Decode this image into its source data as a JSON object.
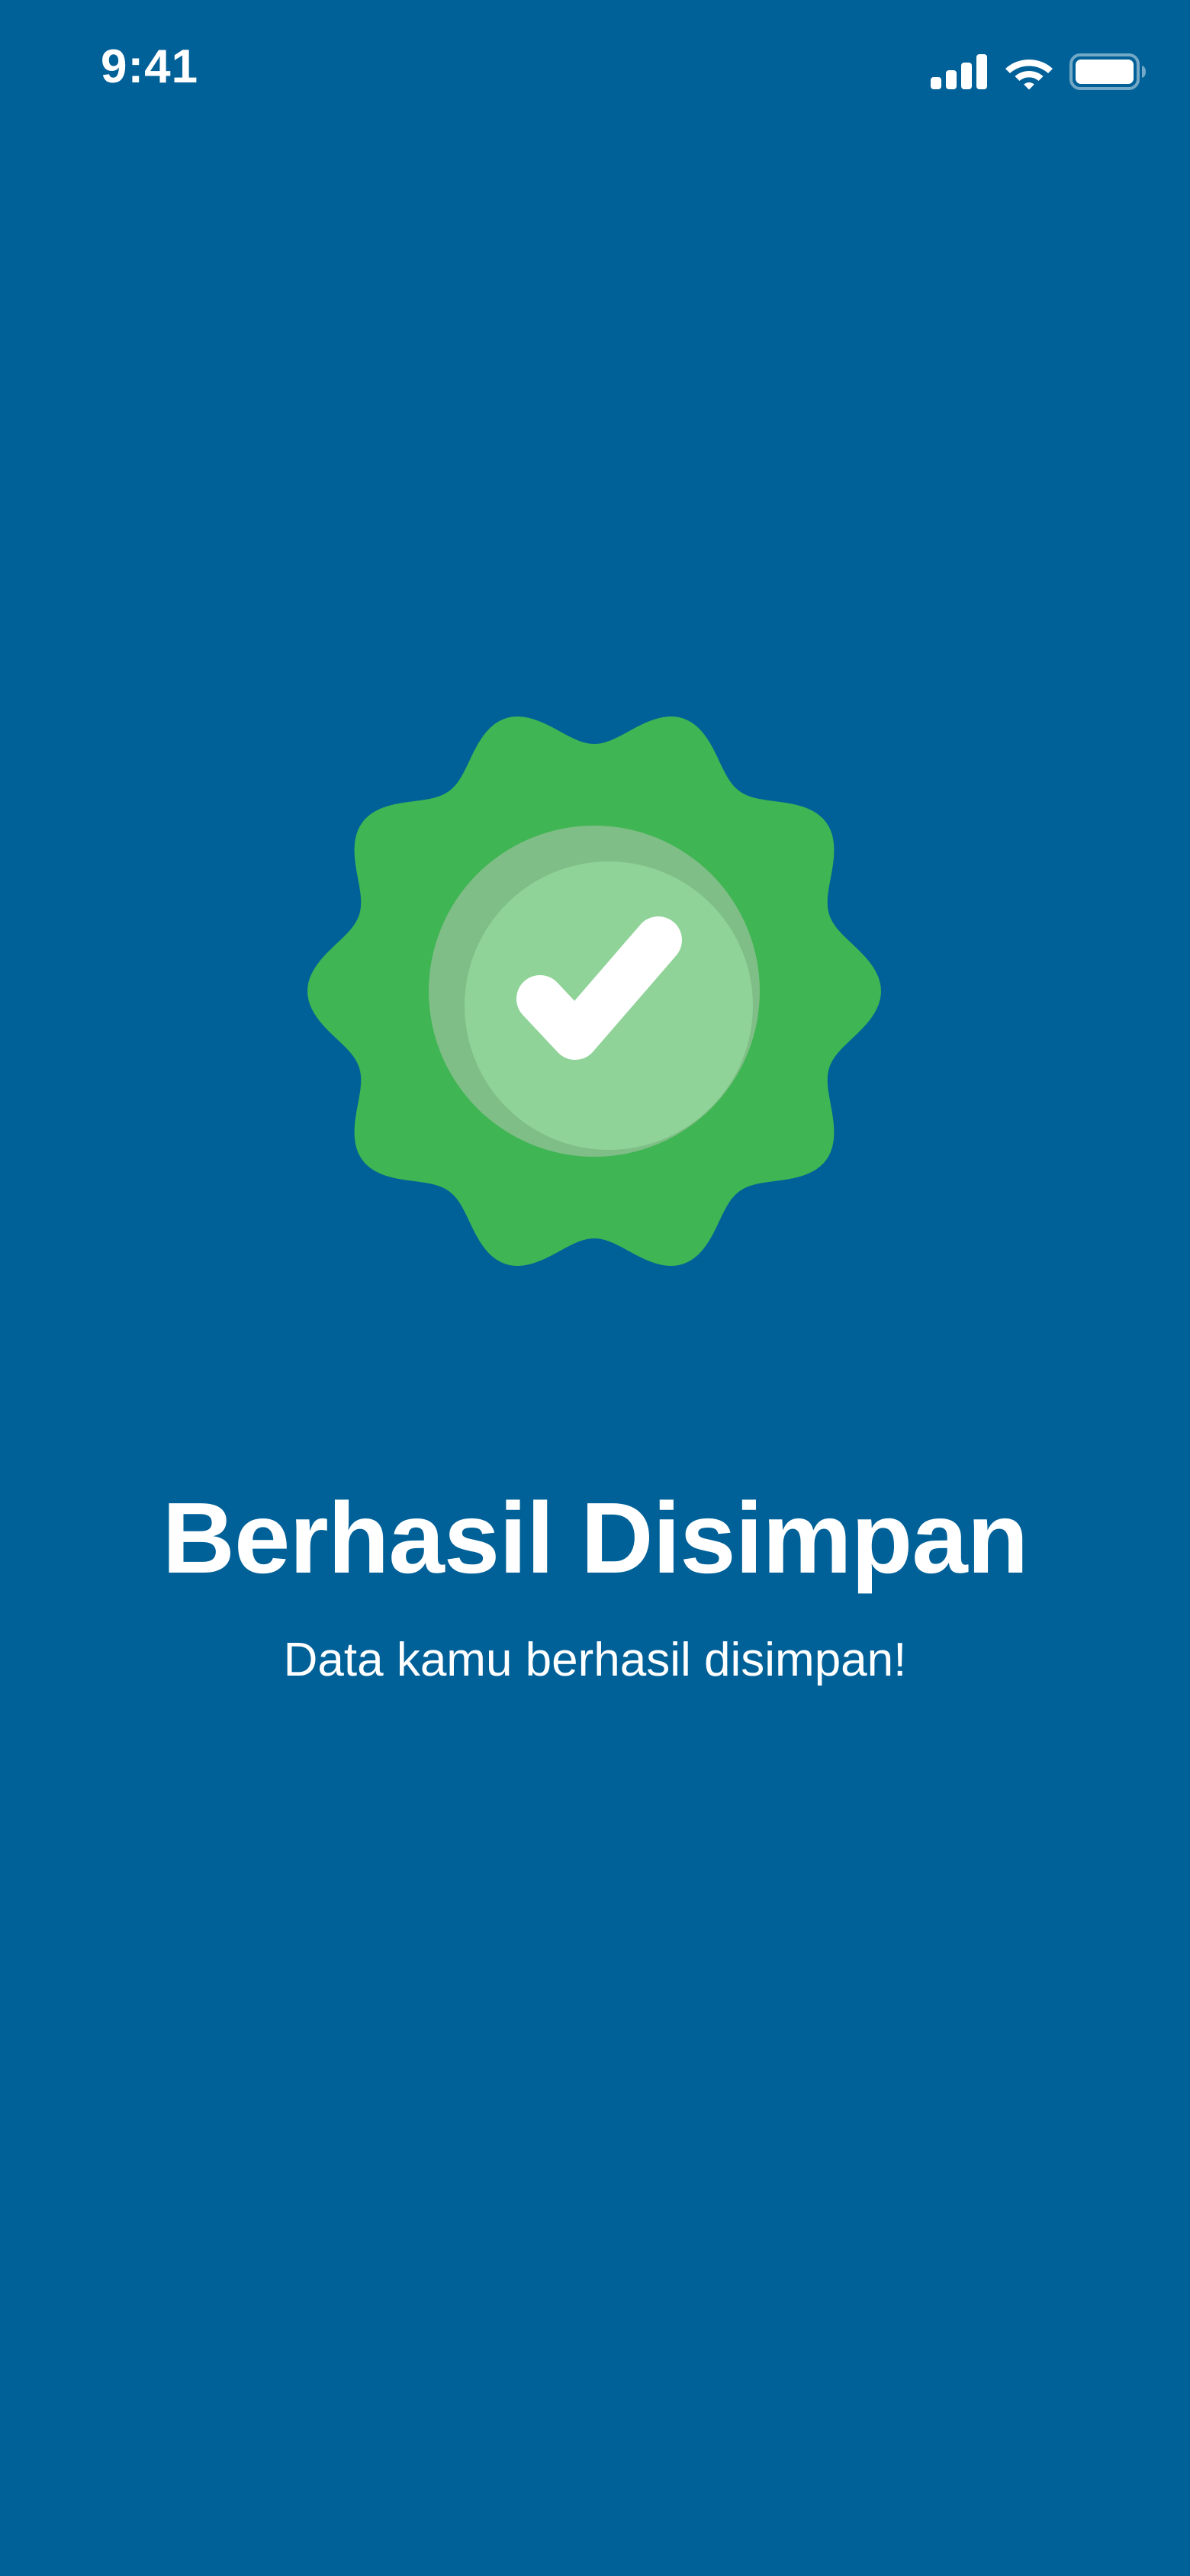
{
  "status_bar": {
    "time": "9:41",
    "icons": [
      "cellular-signal-icon",
      "wifi-icon",
      "battery-icon"
    ]
  },
  "badge": {
    "icon": "verified-check-badge-icon",
    "colors": {
      "outer": "#3FB553",
      "inner": "#8FD398",
      "inner_shadow": "#7FBE86",
      "check": "#FFFFFF"
    }
  },
  "message": {
    "title": "Berhasil Disimpan",
    "subtitle": "Data kamu berhasil disimpan!"
  },
  "theme": {
    "background": "#006198",
    "text": "#FFFFFF"
  }
}
